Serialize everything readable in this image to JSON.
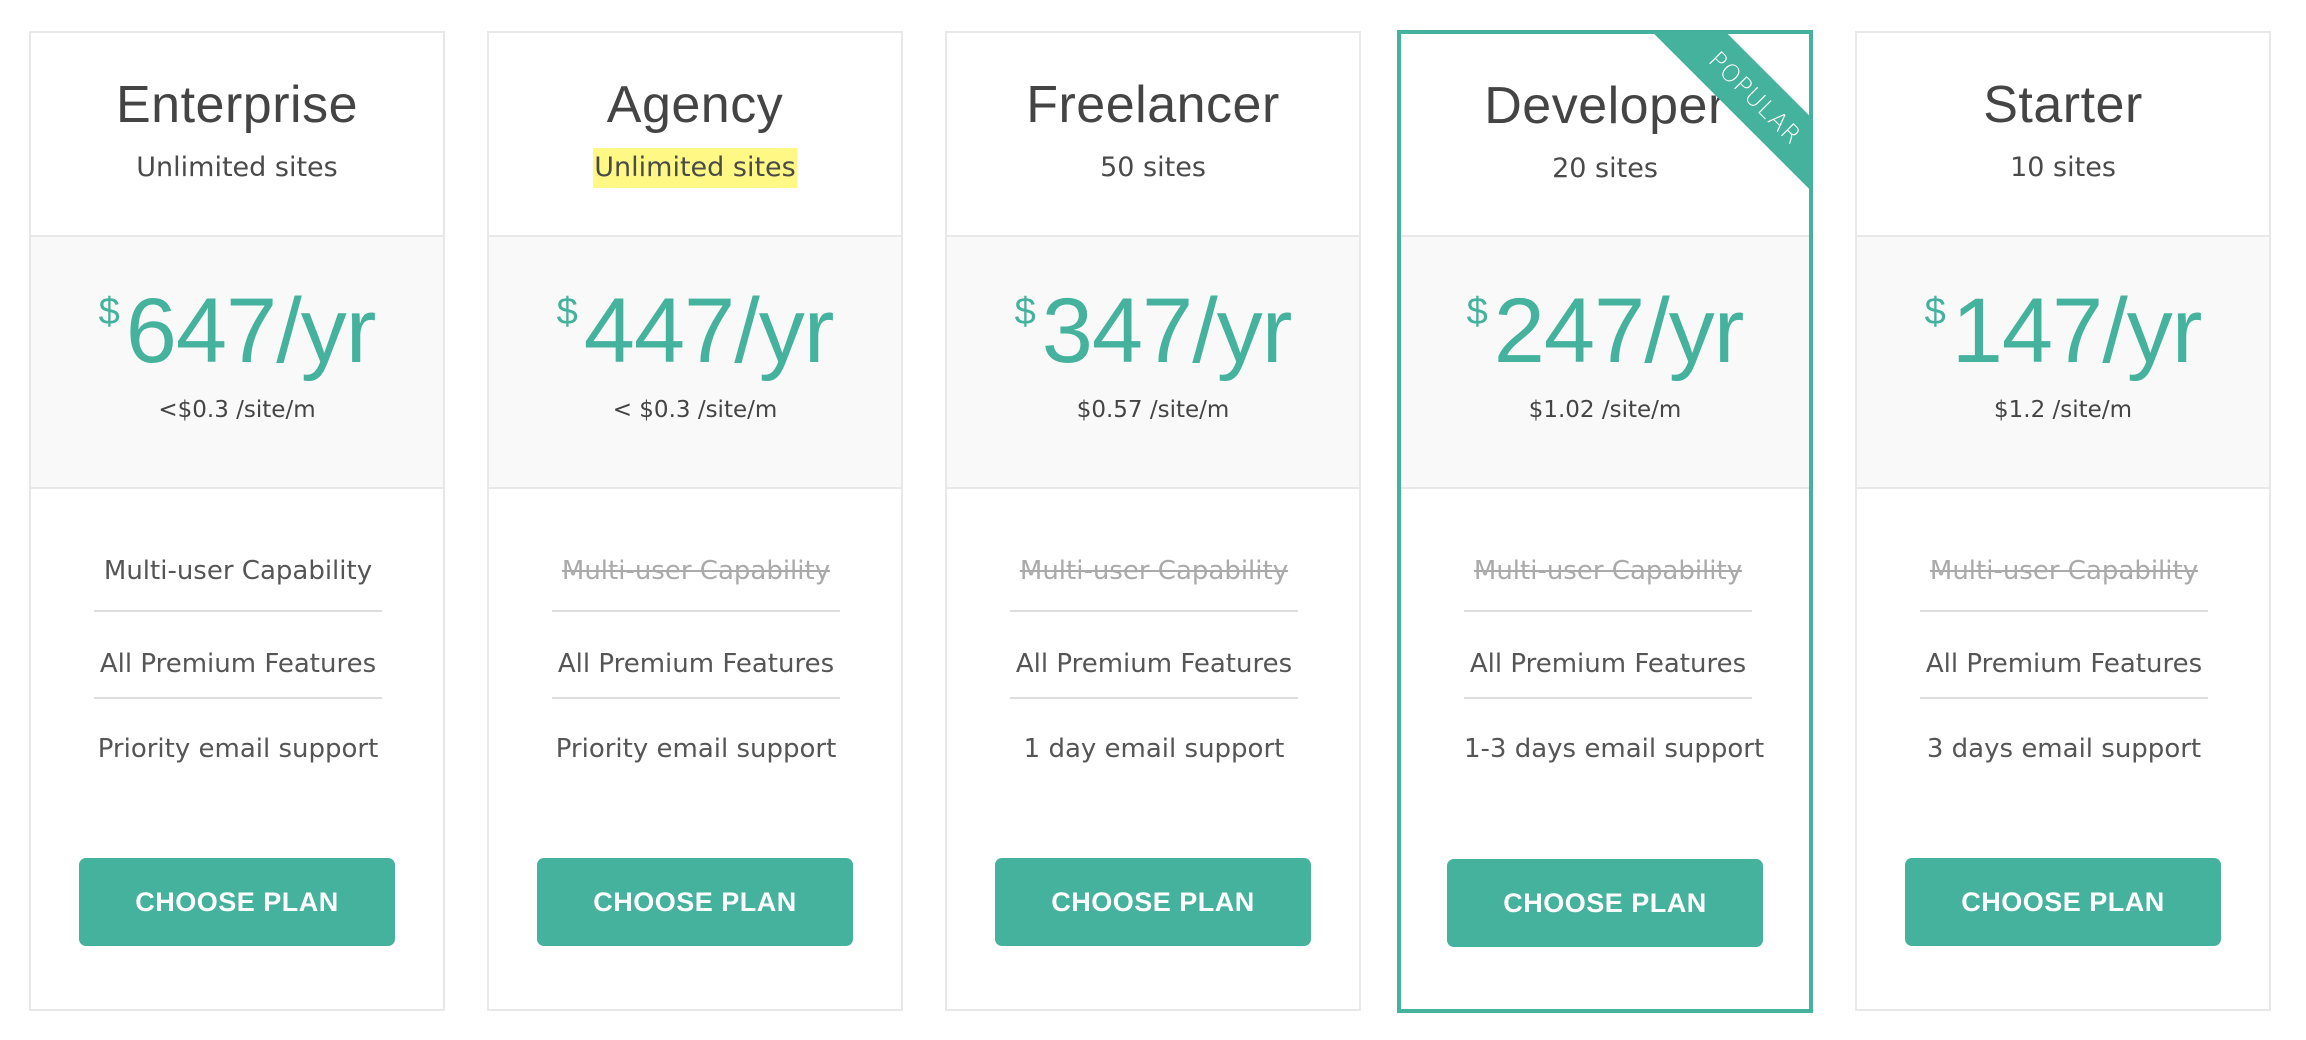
{
  "theme": {
    "accent": "#45b29d",
    "highlight": "#fff884",
    "border": "#e8e8e8",
    "price_bg": "#f9f9f9",
    "disabled_text": "#aaaaaa"
  },
  "plans": [
    {
      "name": "Enterprise",
      "sites": "Unlimited sites",
      "sites_highlighted": false,
      "currency": "$",
      "price": "647/yr",
      "per_site": "<$0.3 /site/m",
      "popular": false,
      "features": [
        {
          "label": "Multi-user Capability",
          "included": true
        },
        {
          "label": "All Premium Features",
          "included": true
        },
        {
          "label": "Priority email support",
          "included": true
        }
      ],
      "button_label": "CHOOSE PLAN"
    },
    {
      "name": "Agency",
      "sites": "Unlimited sites",
      "sites_highlighted": true,
      "currency": "$",
      "price": "447/yr",
      "per_site": "< $0.3 /site/m",
      "popular": false,
      "features": [
        {
          "label": "Multi-user Capability",
          "included": false
        },
        {
          "label": "All Premium Features",
          "included": true
        },
        {
          "label": "Priority email support",
          "included": true
        }
      ],
      "button_label": "CHOOSE PLAN"
    },
    {
      "name": "Freelancer",
      "sites": "50 sites",
      "sites_highlighted": false,
      "currency": "$",
      "price": "347/yr",
      "per_site": "$0.57 /site/m",
      "popular": false,
      "features": [
        {
          "label": "Multi-user Capability",
          "included": false
        },
        {
          "label": "All Premium Features",
          "included": true
        },
        {
          "label": "1 day email support",
          "included": true
        }
      ],
      "button_label": "CHOOSE PLAN"
    },
    {
      "name": "Developer",
      "sites": "20 sites",
      "sites_highlighted": false,
      "currency": "$",
      "price": "247/yr",
      "per_site": "$1.02 /site/m",
      "popular": true,
      "ribbon_label": "POPULAR",
      "features": [
        {
          "label": "Multi-user Capability",
          "included": false
        },
        {
          "label": "All Premium Features",
          "included": true
        },
        {
          "label": "1-3 days email support",
          "included": true
        }
      ],
      "button_label": "CHOOSE PLAN"
    },
    {
      "name": "Starter",
      "sites": "10 sites",
      "sites_highlighted": false,
      "currency": "$",
      "price": "147/yr",
      "per_site": "$1.2 /site/m",
      "popular": false,
      "features": [
        {
          "label": "Multi-user Capability",
          "included": false
        },
        {
          "label": "All Premium Features",
          "included": true
        },
        {
          "label": "3 days email support",
          "included": true
        }
      ],
      "button_label": "CHOOSE PLAN"
    }
  ]
}
